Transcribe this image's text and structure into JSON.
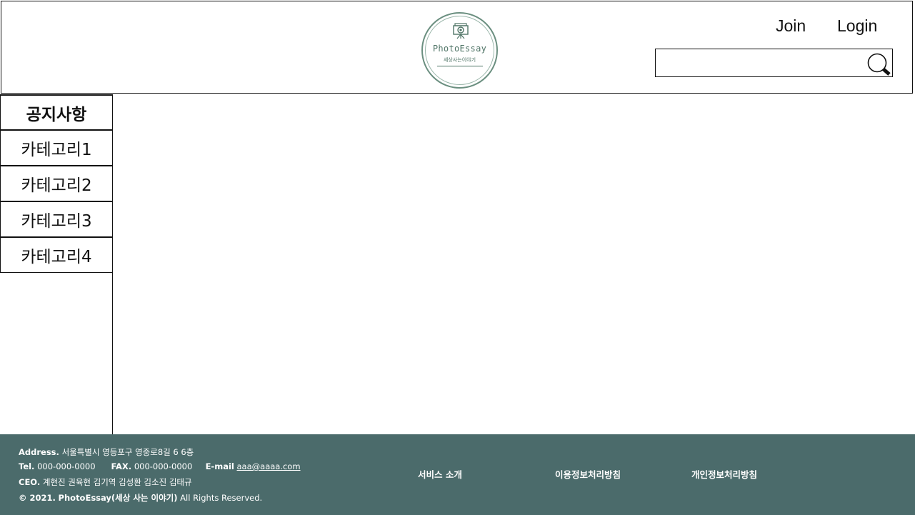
{
  "header": {
    "logo": {
      "title": "PhotoEssay",
      "subtitle": "세상사는이야기",
      "icon": "camera-icon"
    },
    "nav": {
      "join_label": "Join",
      "login_label": "Login"
    },
    "search": {
      "value": "",
      "placeholder": "",
      "icon": "search-icon"
    }
  },
  "sidebar": {
    "items": [
      {
        "label": "공지사항",
        "active": true
      },
      {
        "label": "카테고리1",
        "active": false
      },
      {
        "label": "카테고리2",
        "active": false
      },
      {
        "label": "카테고리3",
        "active": false
      },
      {
        "label": "카테고리4",
        "active": false
      }
    ]
  },
  "footer": {
    "address_label": "Address.",
    "address_value": "서울특별시 영등포구 영중로8길 6 6층",
    "tel_label": "Tel.",
    "tel_value": "000-000-0000",
    "fax_label": "FAX.",
    "fax_value": "000-000-0000",
    "email_label": "E-mail",
    "email_value": "aaa@aaaa.com",
    "ceo_label": "CEO.",
    "ceo_value": "계현진 권육현 김기역 김성환 김소진 김태규",
    "copyright_prefix": "© 2021.",
    "copyright_brand": "PhotoEssay(세상 사는 이야기)",
    "copyright_suffix": "All Rights Reserved.",
    "links": {
      "service": "서비스 소개",
      "terms": "이용정보처리방침",
      "privacy": "개인정보처리방침"
    }
  },
  "colors": {
    "footer_bg": "#4b6b6b",
    "logo_green": "#6b8f80"
  }
}
